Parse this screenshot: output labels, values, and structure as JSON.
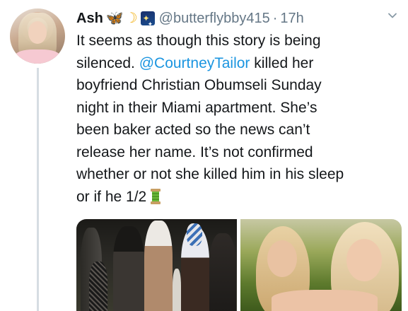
{
  "tweet": {
    "display_name": "Ash",
    "name_emojis": [
      {
        "icon": "butterfly-icon",
        "glyph": "🦋"
      },
      {
        "icon": "crescent-moon-icon",
        "glyph": "☽"
      },
      {
        "icon": "night-sky-stars-icon",
        "glyph": ""
      }
    ],
    "handle": "@butterflybby415",
    "separator": "·",
    "time": "17h",
    "text_before_mention": "It seems as though this story is being\nsilenced. ",
    "mention": "@CourtneyTailor",
    "text_after_mention": " killed her\nboyfriend Christian Obumseli Sunday\nnight in their Miami apartment. She’s\nbeen baker acted so the news can’t\nrelease her name. It’s not confirmed\nwhether or not she killed him in his sleep\nor if he 1/2",
    "trailing_emoji_icon": "thread-spool-icon"
  },
  "colors": {
    "mention": "#1b95e0",
    "meta_text": "#657786",
    "thread_line": "#d6dde3",
    "body_text": "#14171a"
  },
  "media": [
    {
      "icon": "photo-party-crowd-icon"
    },
    {
      "icon": "photo-two-women-selfie-icon"
    }
  ]
}
